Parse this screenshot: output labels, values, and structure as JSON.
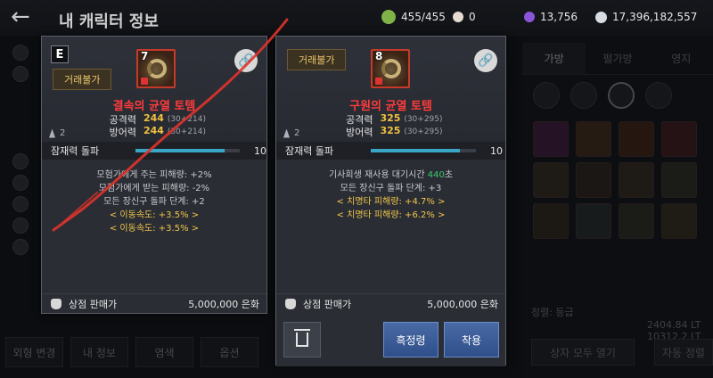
{
  "header": {
    "title": "내 캐릭터 정보",
    "currencies": [
      {
        "icon": "stamina-icon",
        "value": "455/455",
        "color": "#7fb347"
      },
      {
        "icon": "pearl-icon",
        "value": "0",
        "color": "#e8dcd0"
      },
      {
        "icon": "purple-gem-icon",
        "value": "13,756",
        "color": "#8a55d8"
      },
      {
        "icon": "silver-coin-icon",
        "value": "17,396,182,557",
        "color": "#d8dde4"
      }
    ]
  },
  "background": {
    "bottom_tabs": [
      "외형 변경",
      "내 정보",
      "염색",
      "옵션"
    ],
    "right_tabs": [
      "가방",
      "펄가방",
      "영지"
    ],
    "stats": [
      "정렬: 등급",
      "2404.84 LT",
      "10312.2 LT"
    ],
    "open_all": "상자 모두 열기",
    "auto": "자동 정렬"
  },
  "card_left": {
    "grade": "E",
    "untradable": "거래불가",
    "item_level": "7",
    "name": "결속의 균열 토템",
    "attack_label": "공격력",
    "attack_value": "244",
    "attack_detail": "(30+214)",
    "defense_label": "방어력",
    "defense_value": "244",
    "defense_detail": "(30+214)",
    "weight": "2",
    "potential_label": "잠재력 돌파",
    "potential_value": "10",
    "potential_fill": 0.85,
    "effects": [
      {
        "text": "모험가에게 주는 피해량: +2%",
        "gold": false
      },
      {
        "text": "모험가에게 받는 피해량: -2%",
        "gold": false
      },
      {
        "text": "모든 장신구 돌파 단계: +2",
        "gold": false
      },
      {
        "text": "< 이동속도: +3.5% >",
        "gold": true
      },
      {
        "text": "< 이동속도: +3.5% >",
        "gold": true
      }
    ],
    "price_label": "상점 판매가",
    "price_value": "5,000,000 은화"
  },
  "card_right": {
    "untradable": "거래불가",
    "item_level": "8",
    "name": "구원의 균열 토템",
    "attack_label": "공격력",
    "attack_value": "325",
    "attack_detail": "(30+295)",
    "defense_label": "방어력",
    "defense_value": "325",
    "defense_detail": "(30+295)",
    "weight": "2",
    "potential_label": "잠재력 돌파",
    "potential_value": "10",
    "potential_fill": 0.85,
    "revive_prefix": "기사회생 재사용 대기시간 ",
    "revive_value": "440",
    "revive_suffix": "초",
    "effects": [
      {
        "text": "모든 장신구 돌파 단계: +3",
        "gold": false
      },
      {
        "text": "< 치명타 피해량: +4.7% >",
        "gold": true
      },
      {
        "text": "< 치명타 피해량: +6.2% >",
        "gold": true
      }
    ],
    "price_label": "상점 판매가",
    "price_value": "5,000,000 은화",
    "black_spirit_button": "흑정령",
    "equip_button": "착용"
  }
}
